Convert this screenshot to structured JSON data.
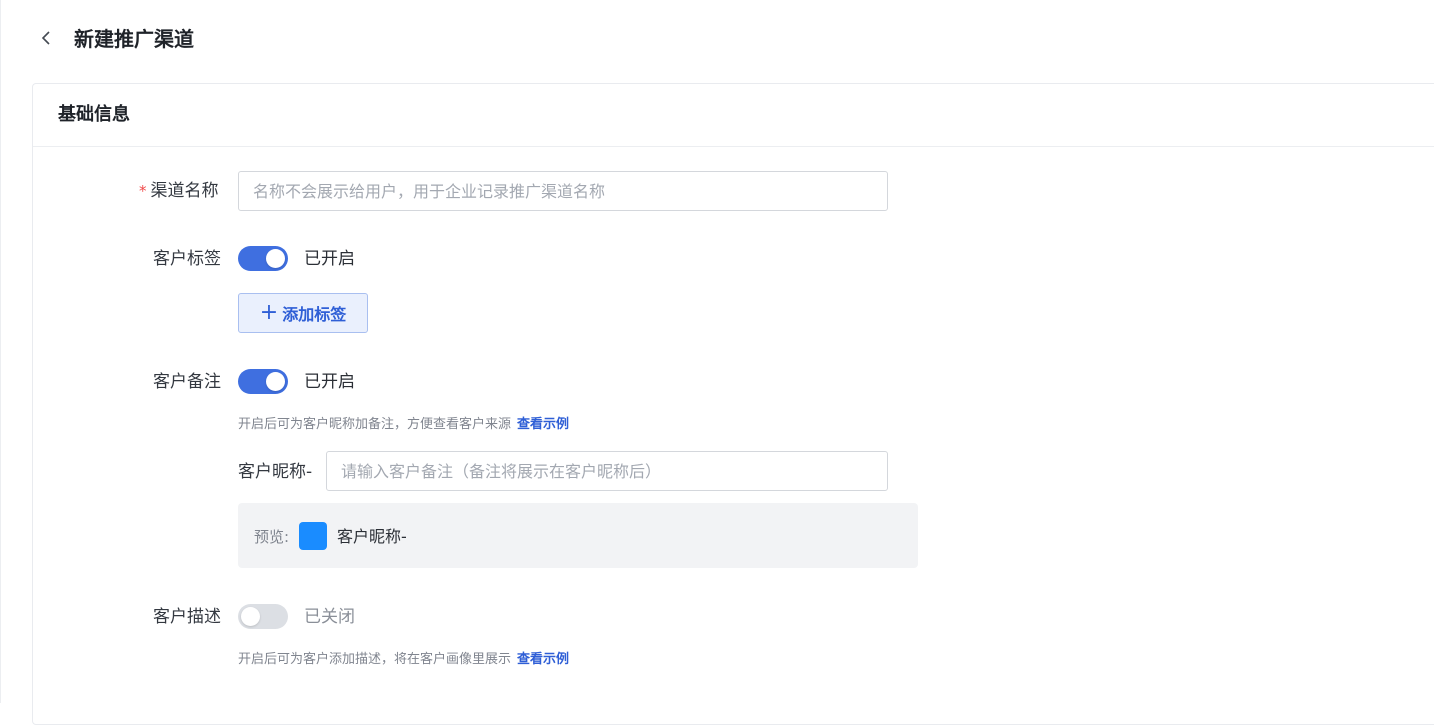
{
  "header": {
    "title": "新建推广渠道"
  },
  "section": {
    "title": "基础信息"
  },
  "fields": {
    "channel_name": {
      "required_mark": "*",
      "label": "渠道名称",
      "placeholder": "名称不会展示给用户，用于企业记录推广渠道名称",
      "value": ""
    },
    "customer_tag": {
      "label": "客户标签",
      "enabled": true,
      "state_text": "已开启",
      "add_button": "添加标签",
      "add_icon": "plus-icon"
    },
    "customer_remark": {
      "label": "客户备注",
      "enabled": true,
      "state_text": "已开启",
      "hint": "开启后可为客户昵称加备注，方便查看客户来源",
      "hint_link": "查看示例",
      "prefix_label": "客户昵称-",
      "placeholder": "请输入客户备注（备注将展示在客户昵称后）",
      "value": "",
      "preview_label": "预览:",
      "preview_name": "客户昵称-"
    },
    "customer_desc": {
      "label": "客户描述",
      "enabled": false,
      "state_text": "已关闭",
      "hint": "开启后可为客户添加描述，将在客户画像里展示",
      "hint_link": "查看示例"
    }
  },
  "colors": {
    "accent": "#3f6fe0",
    "toggle_off": "#dcdfe4",
    "required": "#f04a4a",
    "link": "#2f5fd6",
    "avatar": "#1a8cff"
  }
}
